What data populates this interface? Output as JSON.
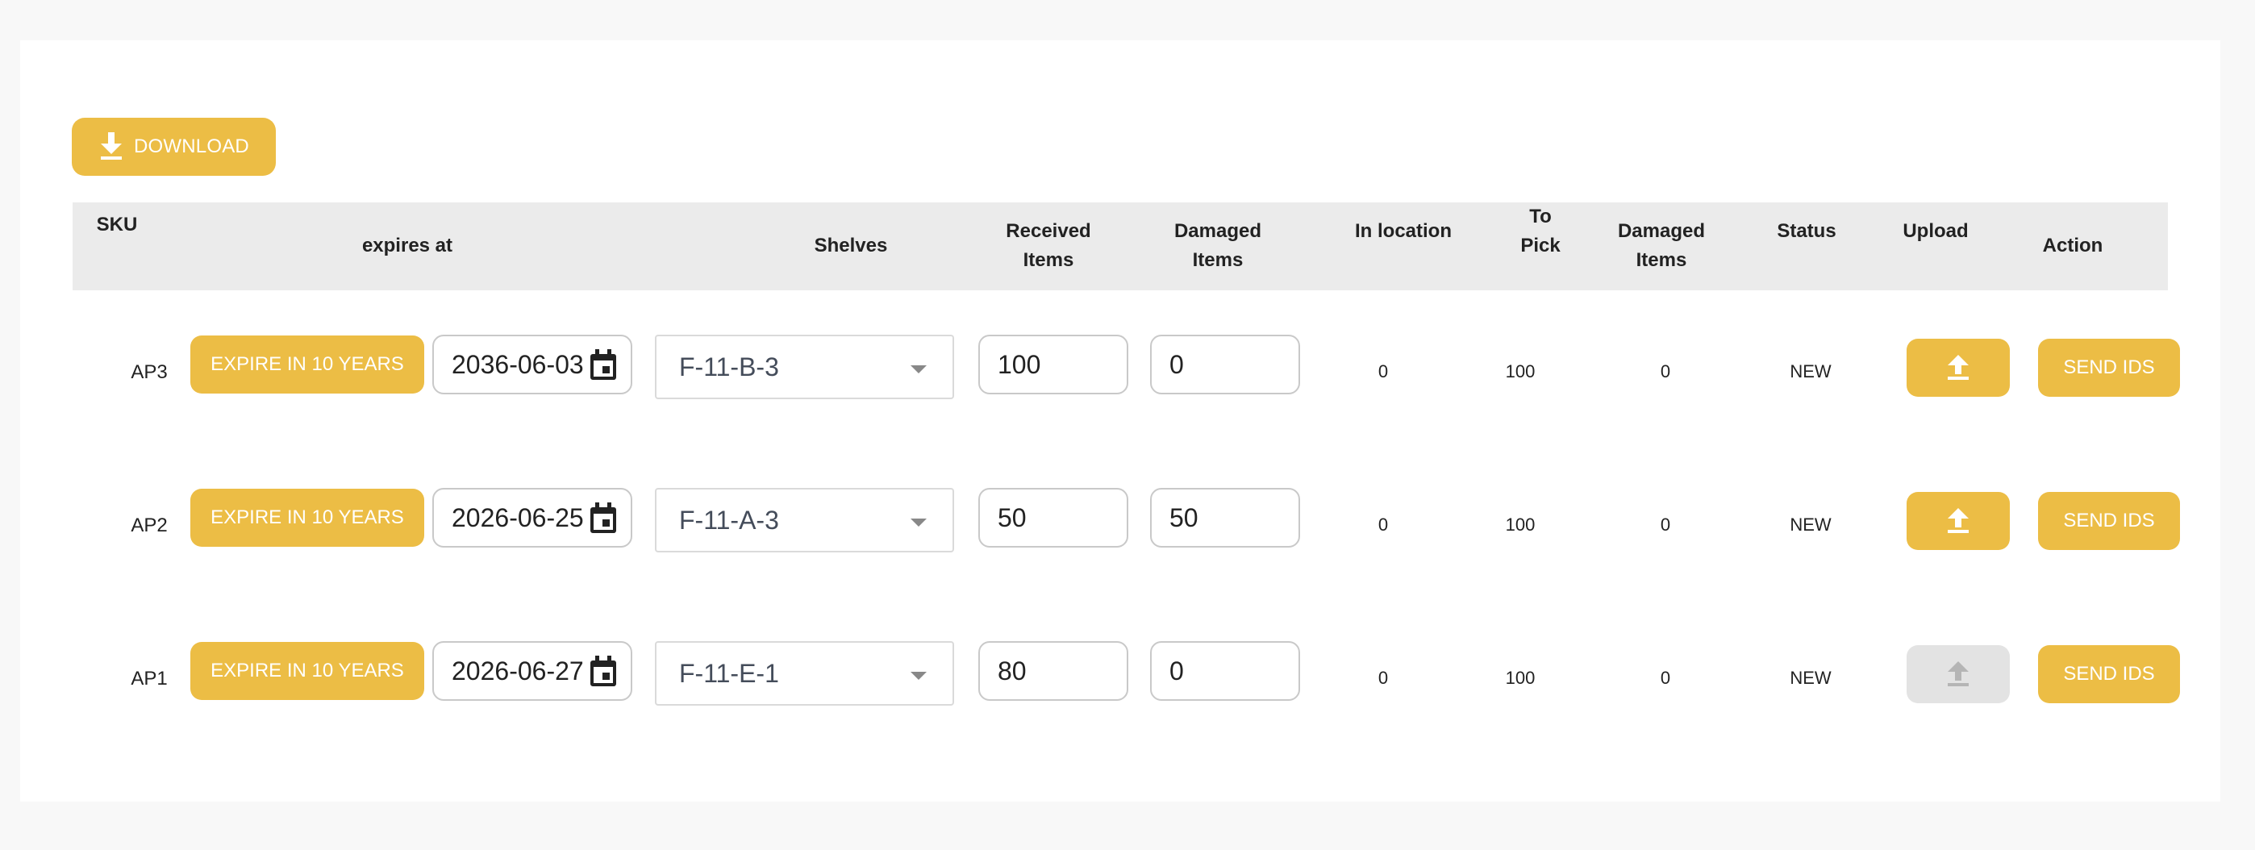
{
  "toolbar": {
    "download_label": "DOWNLOAD"
  },
  "table": {
    "headers": {
      "sku": "SKU",
      "expires_at": "expires at",
      "shelves": "Shelves",
      "received_items_1": "Received",
      "received_items_2": "Items",
      "damaged_items_1": "Damaged",
      "damaged_items_2": "Items",
      "in_location": "In location",
      "to_pick_1": "To",
      "to_pick_2": "Pick",
      "damaged_items2_1": "Damaged",
      "damaged_items2_2": "Items",
      "status": "Status",
      "upload": "Upload",
      "action": "Action"
    },
    "rows": [
      {
        "sku": "AP3",
        "expire_label": "EXPIRE IN 10 YEARS",
        "date": "2036-06-03",
        "shelf": "F-11-B-3",
        "received": "100",
        "damaged": "0",
        "in_location": "0",
        "to_pick": "100",
        "damaged_items": "0",
        "status": "NEW",
        "upload_enabled": true,
        "action_label": "SEND IDS"
      },
      {
        "sku": "AP2",
        "expire_label": "EXPIRE IN 10 YEARS",
        "date": "2026-06-25",
        "shelf": "F-11-A-3",
        "received": "50",
        "damaged": "50",
        "in_location": "0",
        "to_pick": "100",
        "damaged_items": "0",
        "status": "NEW",
        "upload_enabled": true,
        "action_label": "SEND IDS"
      },
      {
        "sku": "AP1",
        "expire_label": "EXPIRE IN 10 YEARS",
        "date": "2026-06-27",
        "shelf": "F-11-E-1",
        "received": "80",
        "damaged": "0",
        "in_location": "0",
        "to_pick": "100",
        "damaged_items": "0",
        "status": "NEW",
        "upload_enabled": false,
        "action_label": "SEND IDS"
      }
    ]
  },
  "colors": {
    "accent": "#ecbd45",
    "header_bg": "#ebebeb",
    "disabled": "#e3e3e3",
    "page_bg": "#f8f8f8"
  },
  "icons": {
    "download": "download-icon",
    "upload": "upload-icon",
    "calendar": "calendar-icon",
    "dropdown": "chevron-down-icon"
  }
}
